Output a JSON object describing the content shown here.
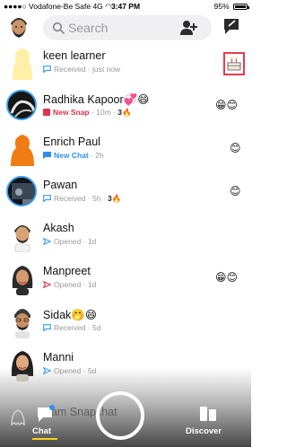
{
  "status_bar": {
    "carrier": "Vodafone-Be Safe",
    "network": "4G",
    "time": "3:47 PM",
    "battery": "95%"
  },
  "header": {
    "search_placeholder": "Search"
  },
  "chats": [
    {
      "name": "keen learner",
      "name_emoji": "",
      "status_kind": "Received",
      "time": "just now",
      "streak": "",
      "right_emoji": "cake-icon"
    },
    {
      "name": "Radhika Kapoor",
      "name_emoji": "💞😄",
      "status_kind": "New Snap",
      "time": "10m",
      "streak": "3🔥",
      "right_emoji": "😁😊"
    },
    {
      "name": "Enrich Paul",
      "name_emoji": "",
      "status_kind": "New Chat",
      "time": "2h",
      "streak": "",
      "right_emoji": "😊"
    },
    {
      "name": "Pawan",
      "name_emoji": "",
      "status_kind": "Received",
      "time": "5h",
      "streak": "3🔥",
      "right_emoji": "😊"
    },
    {
      "name": "Akash",
      "name_emoji": "",
      "status_kind": "Opened",
      "time": "1d",
      "streak": "",
      "right_emoji": ""
    },
    {
      "name": "Manpreet",
      "name_emoji": "",
      "status_kind": "Opened",
      "time": "1d",
      "streak": "",
      "right_emoji": "😁😊"
    },
    {
      "name": "Sidak",
      "name_emoji": "🤭😄",
      "status_kind": "Received",
      "time": "5d",
      "streak": "",
      "right_emoji": ""
    },
    {
      "name": "Manni",
      "name_emoji": "",
      "status_kind": "Opened",
      "time": "5d",
      "streak": "",
      "right_emoji": ""
    }
  ],
  "partial_row": {
    "text": "eam Snapchat"
  },
  "bottom_nav": {
    "chat_label": "Chat",
    "discover_label": "Discover"
  },
  "colors": {
    "new_snap": "#e0334a",
    "new_chat": "#2d8ff0",
    "chat_underline": "#f7d21a"
  }
}
